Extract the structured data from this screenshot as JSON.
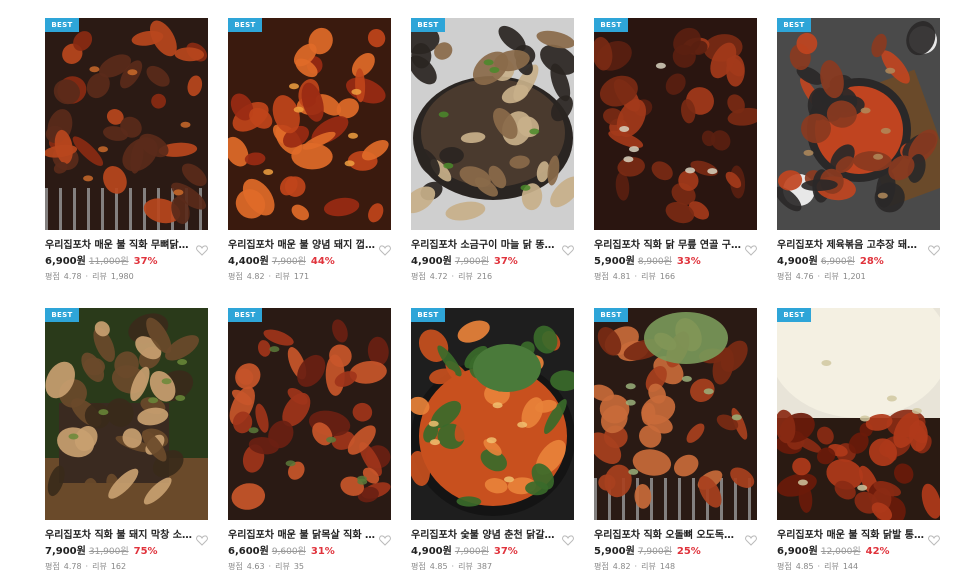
{
  "products": [
    {
      "badge": "BEST",
      "title": "우리집포차 매운 불 직화 무뼈닭발 ...",
      "price": "6,900원",
      "original_price": "11,000원",
      "discount": "37%",
      "rating_label": "평점",
      "rating": "4.78",
      "review_label": "리뷰",
      "reviews": "1,980",
      "image": "grilled-spicy-chicken-feet"
    },
    {
      "badge": "BEST",
      "title": "우리집포차 매운 불 양념 돼지 껍데...",
      "price": "4,400원",
      "original_price": "7,900원",
      "discount": "44%",
      "rating_label": "평점",
      "rating": "4.82",
      "review_label": "리뷰",
      "reviews": "171",
      "image": "spicy-pork-skin"
    },
    {
      "badge": "BEST",
      "title": "우리집포차 소금구이 마늘 닭 똥집 ...",
      "price": "4,900원",
      "original_price": "7,900원",
      "discount": "37%",
      "rating_label": "평점",
      "rating": "4.72",
      "review_label": "리뷰",
      "reviews": "216",
      "image": "garlic-chicken-gizzard"
    },
    {
      "badge": "BEST",
      "title": "우리집포차 직화 닭 무릎 연골 구이...",
      "price": "5,900원",
      "original_price": "8,900원",
      "discount": "33%",
      "rating_label": "평점",
      "rating": "4.81",
      "review_label": "리뷰",
      "reviews": "166",
      "image": "chicken-cartilage"
    },
    {
      "badge": "BEST",
      "title": "우리집포차 제육볶음 고추장 돼지 ...",
      "price": "4,900원",
      "original_price": "6,900원",
      "discount": "28%",
      "rating_label": "평점",
      "rating": "4.76",
      "review_label": "리뷰",
      "reviews": "1,201",
      "image": "stir-fried-pork"
    },
    {
      "badge": "BEST",
      "title": "우리집포차 직화 불 돼지 막창 소금...",
      "price": "7,900원",
      "original_price": "31,900원",
      "discount": "75%",
      "rating_label": "평점",
      "rating": "4.78",
      "review_label": "리뷰",
      "reviews": "162",
      "image": "pork-intestine"
    },
    {
      "badge": "BEST",
      "title": "우리집포차 매운 불 닭목살 직화 구...",
      "price": "6,600원",
      "original_price": "9,600원",
      "discount": "31%",
      "rating_label": "평점",
      "rating": "4.63",
      "review_label": "리뷰",
      "reviews": "35",
      "image": "chicken-neck"
    },
    {
      "badge": "BEST",
      "title": "우리집포차 숯불 양념 춘천 닭갈비 ...",
      "price": "4,900원",
      "original_price": "7,900원",
      "discount": "37%",
      "rating_label": "평점",
      "rating": "4.85",
      "review_label": "리뷰",
      "reviews": "387",
      "image": "dakgalbi"
    },
    {
      "badge": "BEST",
      "title": "우리집포차 직화 오돌뼈 오도독뼈 ...",
      "price": "5,900원",
      "original_price": "7,900원",
      "discount": "25%",
      "rating_label": "평점",
      "rating": "4.82",
      "review_label": "리뷰",
      "reviews": "148",
      "image": "pork-cartilage"
    },
    {
      "badge": "BEST",
      "title": "우리집포차 매운 불 직화 닭발 통 ...",
      "price": "6,900원",
      "original_price": "12,000원",
      "discount": "42%",
      "rating_label": "평점",
      "rating": "4.85",
      "review_label": "리뷰",
      "reviews": "144",
      "image": "whole-chicken-feet"
    }
  ],
  "colors": {
    "badge": "#2ea5d8",
    "discount": "#e0333c"
  }
}
